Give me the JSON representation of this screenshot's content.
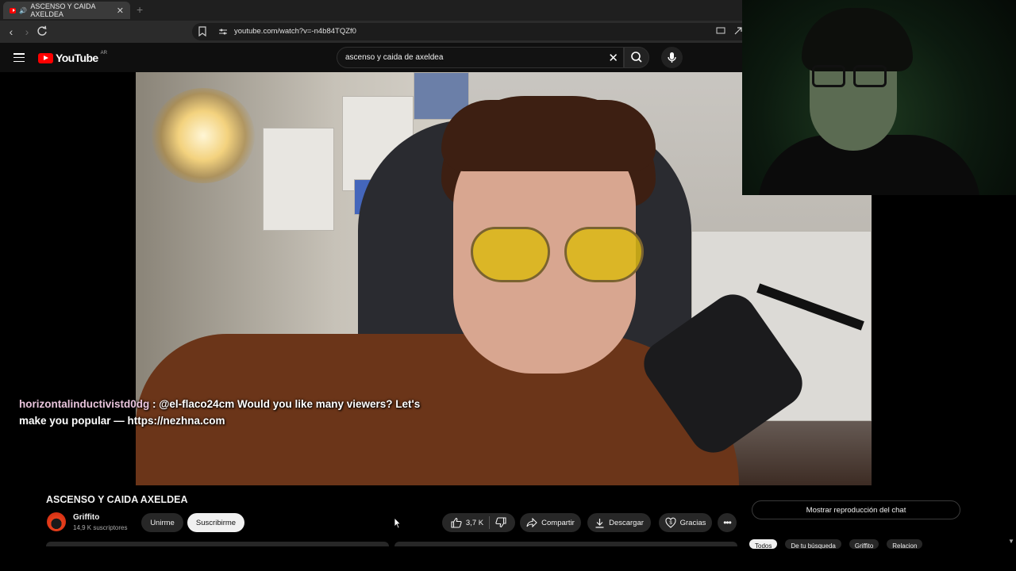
{
  "browser": {
    "tab_title": "ASCENSO Y CAIDA AXELDEA",
    "url": "youtube.com/watch?v=-n4b84TQZf0"
  },
  "youtube": {
    "logo_text": "YouTube",
    "country_code": "AR",
    "search_query": "ascenso y caida de axeldea"
  },
  "chat_overlay": {
    "username": "horizontalinductivistd0dg",
    "message": " : @el-flaco24cm Would you like many viewers? Let's make you popular — https://nezhna.com"
  },
  "video": {
    "title": "ASCENSO Y CAIDA AXELDEA",
    "channel_name": "Griffito",
    "subscribers": "14,9 K suscriptores",
    "join_label": "Unirme",
    "subscribe_label": "Suscribirme",
    "like_count": "3,7 K",
    "share_label": "Compartir",
    "download_label": "Descargar",
    "thanks_label": "Gracias"
  },
  "sidebar": {
    "chat_replay_label": "Mostrar reproducción del chat",
    "chips": [
      "Todos",
      "De tu búsqueda",
      "Griffito",
      "Relacion"
    ]
  },
  "colors": {
    "youtube_red": "#ff0000",
    "background": "#0f0f0f",
    "chat_username": "#e9c4dc"
  }
}
